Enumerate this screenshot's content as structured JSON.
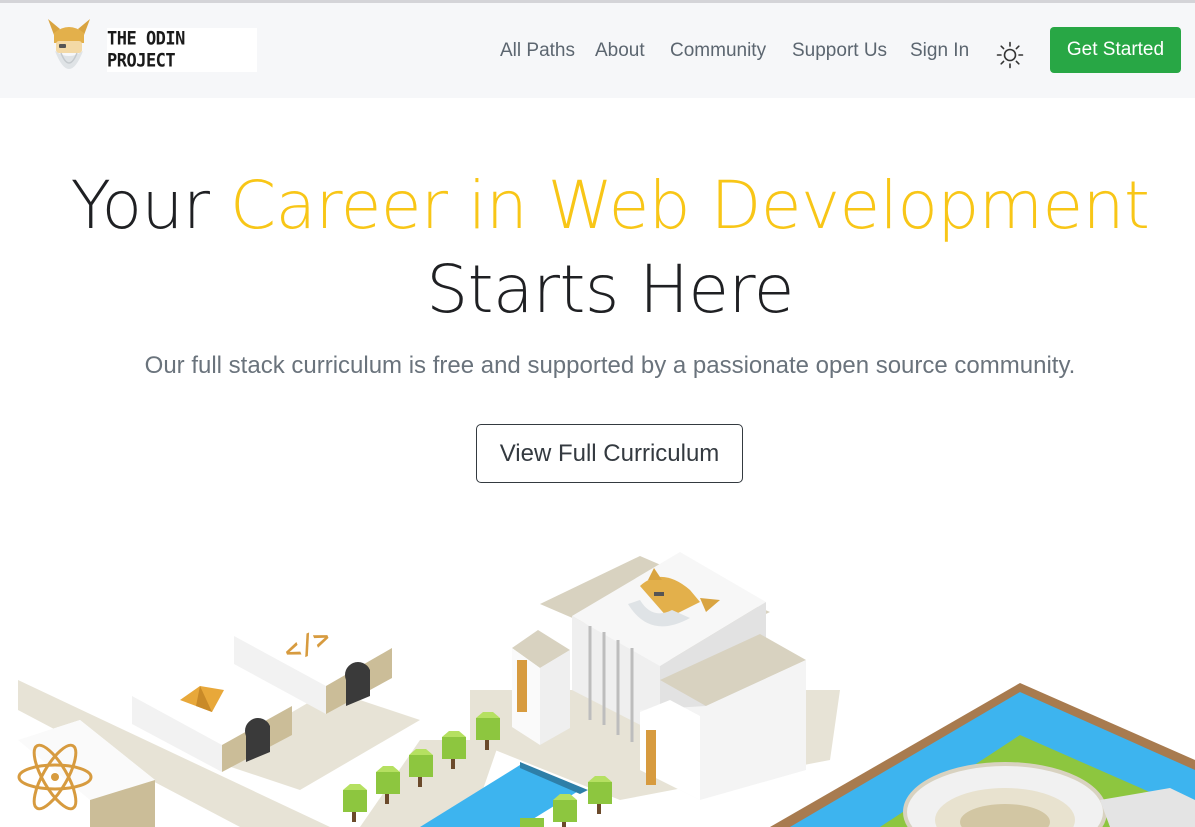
{
  "navbar": {
    "logo_text": "THE ODIN PROJECT",
    "links": [
      "All Paths",
      "About",
      "Community",
      "Support Us",
      "Sign In"
    ],
    "theme_icon": "sun-icon",
    "cta_label": "Get Started"
  },
  "hero": {
    "title_prefix": "Your ",
    "title_accent": "Career in Web Development",
    "title_suffix": "Starts Here",
    "subtitle": "Our full stack curriculum is free and supported by a passionate open source community.",
    "button_label": "View Full Curriculum"
  },
  "illustration": {
    "building_icons": [
      "atom-icon",
      "gem-icon",
      "code-tag-icon",
      "odin-logo-icon"
    ],
    "code_tag_text": "</>"
  },
  "colors": {
    "accent_yellow": "#f8c617",
    "cta_green": "#28a745",
    "navbar_bg": "#f6f7f9",
    "water_blue": "#3db4ef",
    "grass_green": "#8dc63f"
  }
}
